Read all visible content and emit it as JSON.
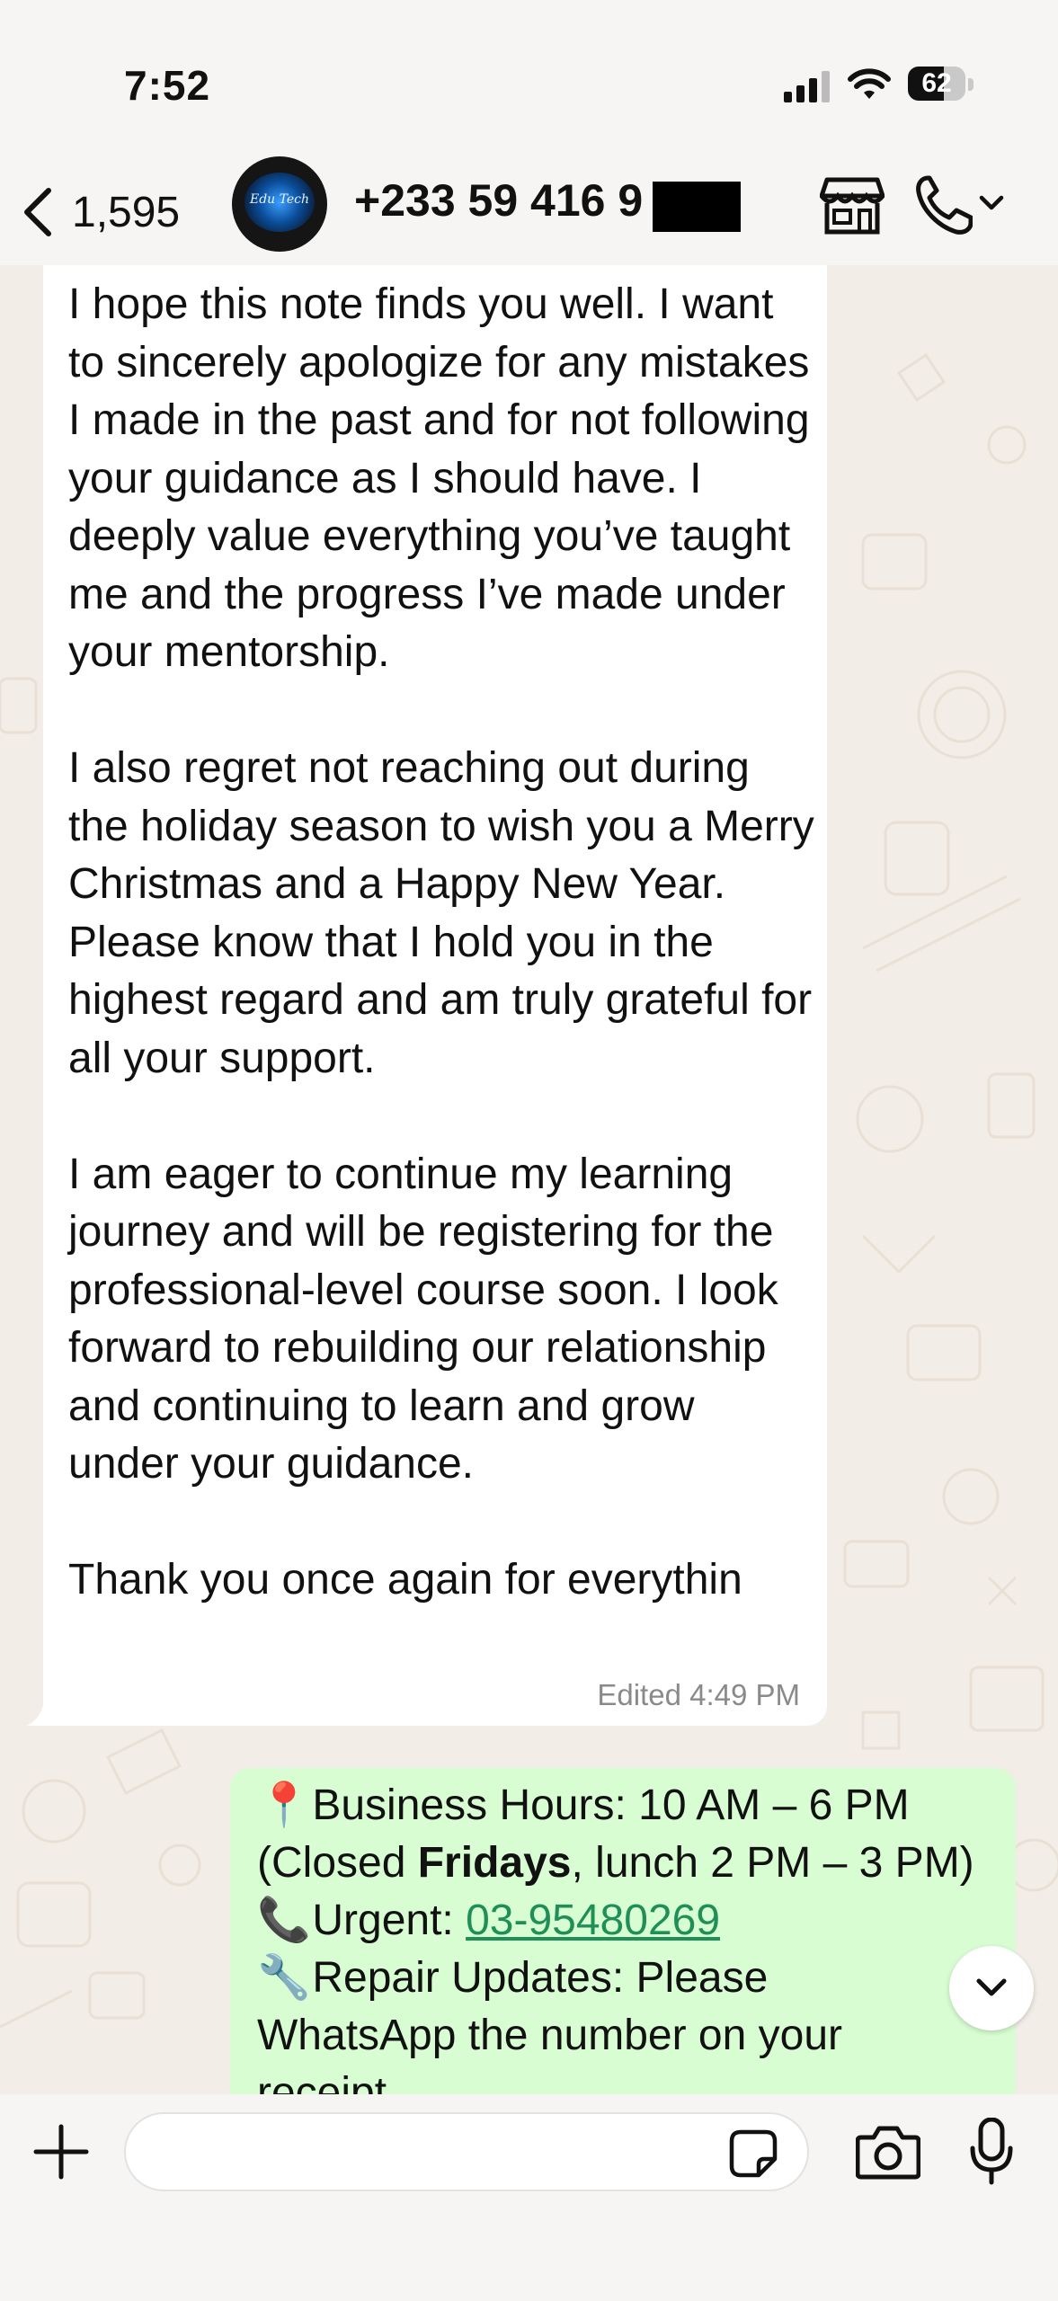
{
  "status_bar": {
    "time": "7:52",
    "battery_level": "62",
    "battery_fraction": 0.62,
    "icons": [
      "cellular-signal-icon",
      "wifi-icon",
      "battery-icon"
    ]
  },
  "header": {
    "back_count": "1,595",
    "contact_name": "+233 59 416 9",
    "avatar_text": "Edu Tech",
    "icons": [
      "back-chevron-icon",
      "store-icon",
      "phone-icon",
      "chevron-down-icon"
    ]
  },
  "incoming_message": {
    "paragraphs": [
      "I hope this note finds you well. I want to sincerely apologize for any mistakes I made in the past and for not following your guidance as I should have. I deeply value everything you’ve taught me and the progress I’ve made under your mentorship.",
      "I also regret not reaching out during the holiday season to wish you a Merry Christmas and a Happy New Year. Please know that I hold you in the highest regard and am truly grateful for all your support.",
      "I am eager to continue my learning journey and will be registering for the professional-level course soon. I look forward to rebuilding our relationship and continuing to learn and grow under your guidance.",
      "Thank you once again for everythin"
    ],
    "meta": "Edited 4:49 PM"
  },
  "outgoing_message": {
    "line1_emoji": "📍",
    "line1_text": "Business Hours: 10 AM – 6 PM",
    "line2_pre": "(Closed ",
    "line2_bold": "Fridays",
    "line2_post": ", lunch 2 PM – 3 PM)",
    "line3_emoji": "📞",
    "line3_label": "Urgent: ",
    "line3_phone": "03-95480269",
    "line4_emoji": "🔧",
    "line4_text": "Repair Updates: Please",
    "line5_text": "WhatsApp the number on your",
    "line6_text": "receipt"
  },
  "composer": {
    "placeholder": "",
    "icons": [
      "plus-icon",
      "sticker-icon",
      "camera-icon",
      "microphone-icon"
    ]
  },
  "colors": {
    "incoming_bubble": "#ffffff",
    "outgoing_bubble": "#d8fdd2",
    "chat_background": "#f2ede6",
    "link": "#1f8f57"
  }
}
